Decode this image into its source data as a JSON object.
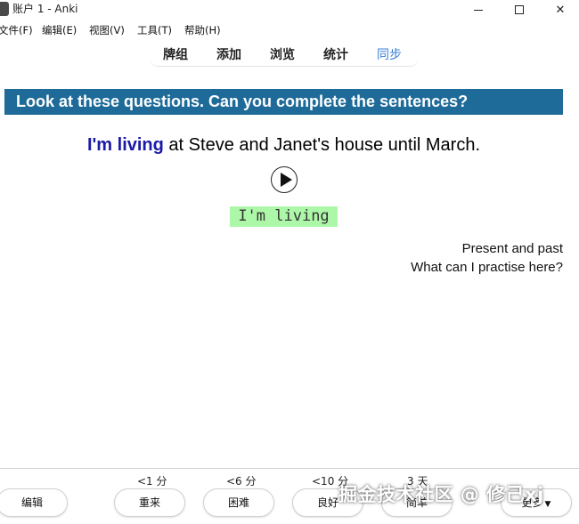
{
  "window": {
    "title": "账户 1 - Anki",
    "icon": "anki-icon"
  },
  "menu": {
    "file": "文件(F)",
    "edit": "编辑(E)",
    "view": "视图(V)",
    "tools": "工具(T)",
    "help": "帮助(H)"
  },
  "toolbar": {
    "decks": "牌组",
    "add": "添加",
    "browse": "浏览",
    "stats": "统计",
    "sync": "同步",
    "sync_color": "#3b7fd4"
  },
  "card": {
    "banner": "Look at these questions. Can you complete the sentences?",
    "banner_color": "#1e6b99",
    "cloze": "I'm living",
    "sentence_rest": " at Steve and Janet's house until March.",
    "answer": "I'm living",
    "answer_bg": "#adf7a9",
    "note_line1": "Present and past",
    "note_line2": "What can I practise here?",
    "play_icon": "play-icon"
  },
  "answer_bar": {
    "edit_label": "编辑",
    "again_interval": "<1 分",
    "again_label": "重来",
    "hard_interval": "<6 分",
    "hard_label": "困难",
    "good_interval": "<10 分",
    "good_label": "良好",
    "easy_interval": "3 天",
    "easy_label": "简单",
    "more_label": "更多"
  },
  "watermark": "掘金技术社区 @ 修己xj"
}
